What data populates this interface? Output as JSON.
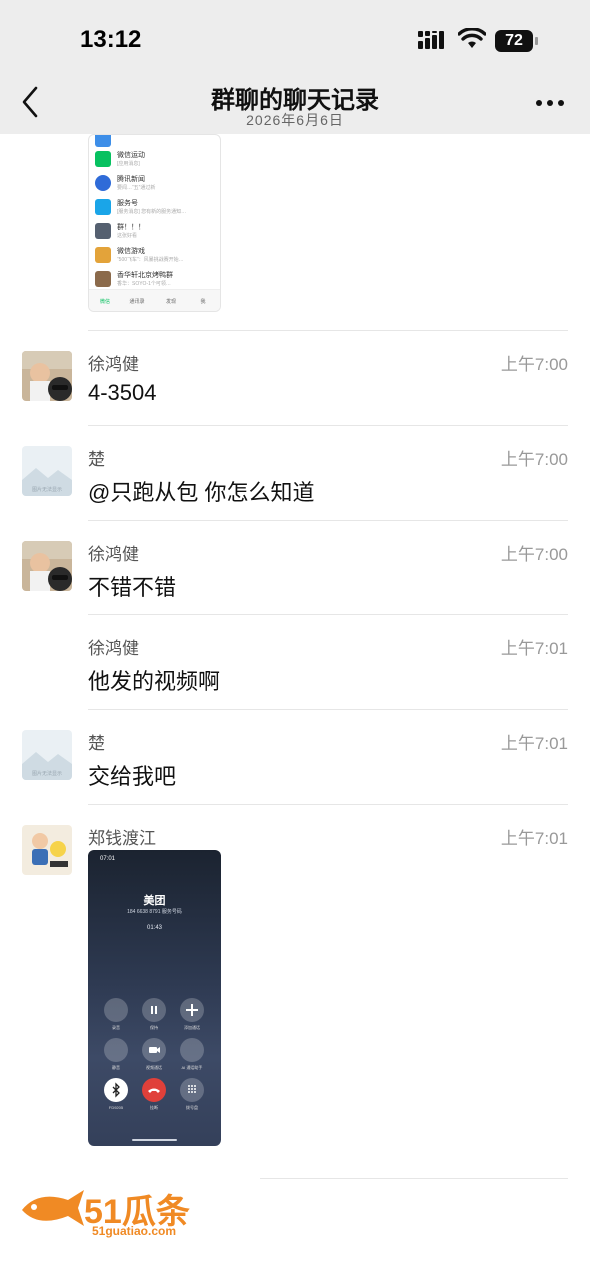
{
  "status": {
    "time": "13:12",
    "battery": "72"
  },
  "header": {
    "title": "群聊的聊天记录",
    "subtitle": "2026年6月6日"
  },
  "shared_screenshot_wechat": {
    "items": [
      {
        "name": "微信运动",
        "desc": "[应用消息]",
        "icon_color": "#07c160"
      },
      {
        "name": "腾讯新闻",
        "desc": "要闻…“五”通过新",
        "icon_color": "#2f6bd8"
      },
      {
        "name": "服务号",
        "desc": "[服务消息] 您有新的服务通知…",
        "icon_color": "#1aa5e8"
      },
      {
        "name": "群！！！",
        "desc": "这张好看",
        "icon_color": "#556070"
      },
      {
        "name": "微信游戏",
        "desc": "“500飞车”：风暴挑战赛开始…",
        "icon_color": "#e3a33a"
      },
      {
        "name": "香华轩北京烤鸭群",
        "desc": "香华：SOYO-1个可领…",
        "icon_color": "#8b6a4b"
      }
    ],
    "tabs": [
      "微信",
      "通讯录",
      "发现",
      "我"
    ]
  },
  "messages": [
    {
      "sender": "徐鸿健",
      "time": "上午7:00",
      "text": "4-3504",
      "avatar": "photo-boy-icon"
    },
    {
      "sender": "楚",
      "time": "上午7:00",
      "text": "@只跑从包 你怎么知道",
      "avatar": "image-placeholder-icon"
    },
    {
      "sender": "徐鸿健",
      "time": "上午7:00",
      "text": "不错不错",
      "avatar": "photo-boy-icon"
    },
    {
      "sender": "徐鸿健",
      "time": "上午7:01",
      "text": "他发的视频啊",
      "avatar": ""
    },
    {
      "sender": "楚",
      "time": "上午7:01",
      "text": "交给我吧",
      "avatar": "image-placeholder-icon"
    },
    {
      "sender": "郑钱渡江",
      "time": "上午7:01",
      "text": "",
      "avatar": "cartoon-icon"
    }
  ],
  "call_screenshot": {
    "status_time": "07:01",
    "caller": "美团",
    "number": "184 6638 8791 服务号码",
    "duration": "01:43",
    "buttons": [
      "录音",
      "保持",
      "添加通话",
      "静音",
      "视频通话",
      "AI 通话助手",
      "FD9205",
      "挂断",
      "拨号盘"
    ]
  },
  "watermark": {
    "brand": "51瓜条",
    "url": "51guatiao.com"
  },
  "placeholder_caption": "图片无法显示"
}
